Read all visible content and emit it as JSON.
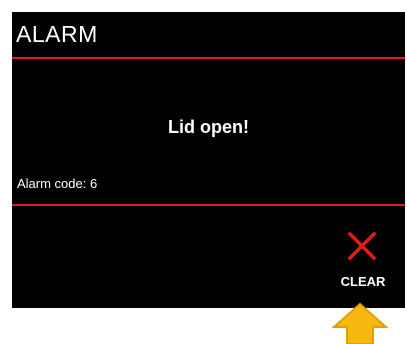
{
  "dialog": {
    "title": "ALARM",
    "message": "Lid open!",
    "alarm_code": "Alarm code: 6"
  },
  "actions": {
    "clear_label": "CLEAR",
    "clear_icon": "close-x-icon"
  },
  "pointer": {
    "icon": "arrow-up-icon"
  },
  "colors": {
    "background": "#000000",
    "text": "#ffffff",
    "accent_red": "#e31b1b",
    "arrow_fill": "#f7b80f",
    "arrow_stroke": "#e0a000"
  }
}
